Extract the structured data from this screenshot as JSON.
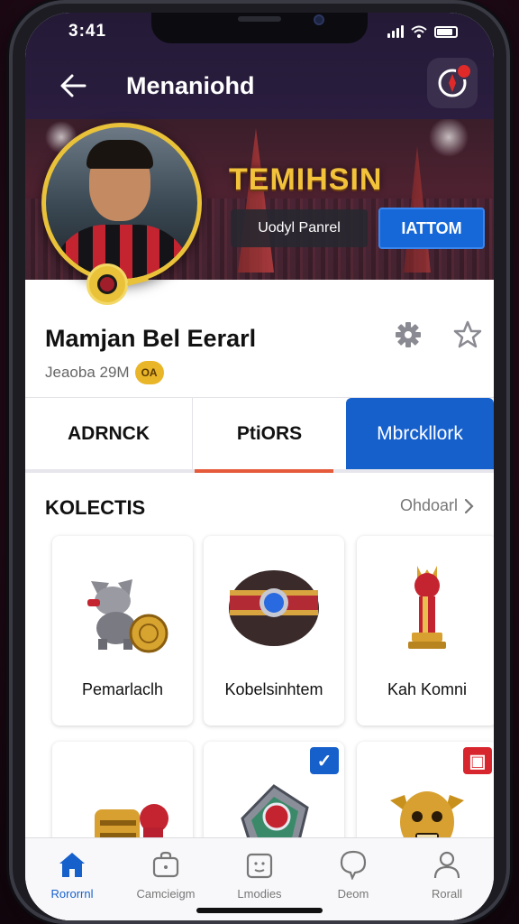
{
  "status_bar": {
    "time": "3:41"
  },
  "header": {
    "title": "Menaniohd"
  },
  "banner": {
    "title": "TEMIHSIN",
    "subtitle": "Uodyl Panrel",
    "action_label": "IATTOM"
  },
  "profile": {
    "name": "Mamjan Bel Eerarl",
    "meta": "Jeaoba 29M",
    "badge": "OA"
  },
  "tabs": [
    {
      "label": "ADRNCK"
    },
    {
      "label": "PtiORS"
    },
    {
      "label": "Mbrckllork"
    }
  ],
  "section": {
    "title": "KOLECTIS",
    "link": "Ohdoarl"
  },
  "collection": [
    {
      "label": "Pemarlaclh"
    },
    {
      "label": "Kobelsinhtem"
    },
    {
      "label": "Kah Komni"
    },
    {
      "label": ""
    },
    {
      "label": ""
    },
    {
      "label": ""
    }
  ],
  "bottom_nav": [
    {
      "label": "Rororrnl",
      "icon": "home-icon"
    },
    {
      "label": "Camcieigm",
      "icon": "bag-icon"
    },
    {
      "label": "Lmodies",
      "icon": "calendar-icon"
    },
    {
      "label": "Deom",
      "icon": "chat-icon"
    },
    {
      "label": "Rorall",
      "icon": "profile-icon"
    }
  ],
  "colors": {
    "accent": "#1660cc",
    "gold": "#f2c23a",
    "tab_underline": "#e45a3a"
  }
}
